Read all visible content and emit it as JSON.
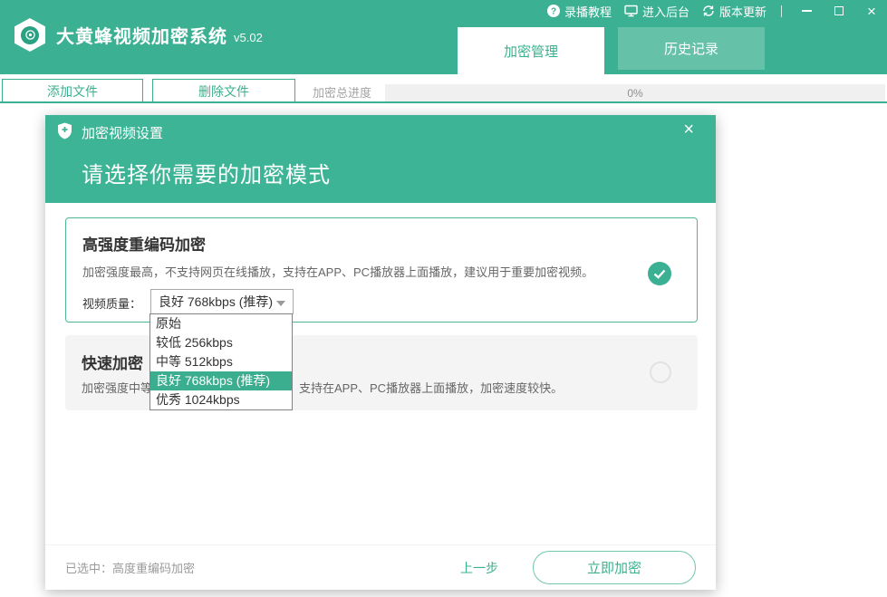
{
  "colors": {
    "accent": "#3bb092",
    "accent_text": "#3cb08e",
    "tab_inactive": "#66c1a9"
  },
  "app": {
    "title": "大黄蜂视频加密系统",
    "version": "v5.02"
  },
  "topbar": {
    "menu": [
      {
        "label": "录播教程",
        "icon": "help-circle-icon"
      },
      {
        "label": "进入后台",
        "icon": "monitor-icon"
      },
      {
        "label": "版本更新",
        "icon": "refresh-icon"
      }
    ],
    "window_controls": {
      "close": "×"
    }
  },
  "tabs": [
    {
      "label": "加密管理",
      "active": true
    },
    {
      "label": "历史记录",
      "active": false
    }
  ],
  "toolbar": {
    "add_button": "添加文件",
    "delete_button": "删除文件",
    "progress_label": "加密总进度",
    "progress_value": "0%"
  },
  "dialog": {
    "header_label": "加密视频设置",
    "close": "×",
    "title": "请选择你需要的加密模式",
    "mode_high": {
      "title": "高强度重编码加密",
      "description": "加密强度最高，不支持网页在线播放，支持在APP、PC播放器上面播放，建议用于重要加密视频。",
      "quality_label": "视频质量：",
      "quality_value": "良好 768kbps (推荐)"
    },
    "quality_dropdown": {
      "options": [
        "原始",
        "较低 256kbps",
        "中等 512kbps",
        "良好 768kbps (推荐)",
        "优秀 1024kbps"
      ],
      "selected": "良好 768kbps (推荐)"
    },
    "mode_fast": {
      "title": "快速加密",
      "description_visible_start": "加密强度中等",
      "description_visible_end": "支持在APP、PC播放器上面播放，加密速度较快。"
    },
    "footer": {
      "selected_text": "已选中：高度重编码加密",
      "back_button": "上一步",
      "encrypt_button": "立即加密"
    }
  }
}
